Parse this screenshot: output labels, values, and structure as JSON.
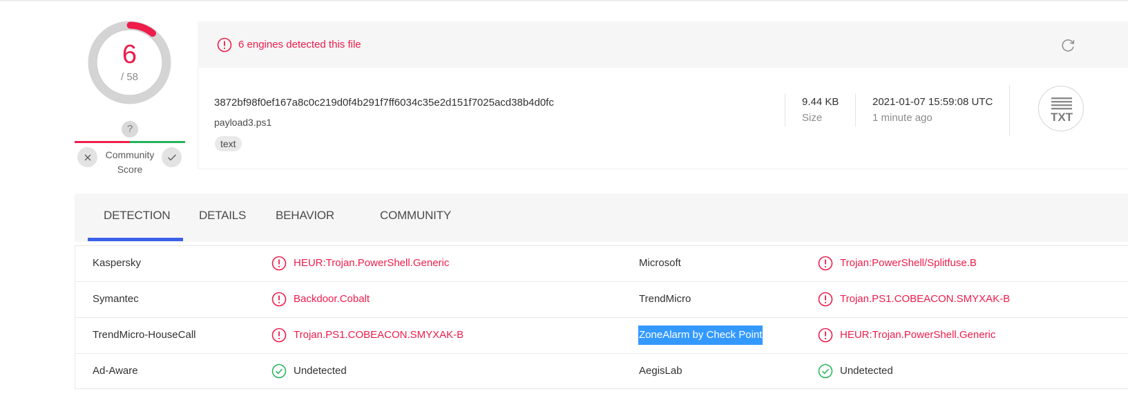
{
  "score": {
    "detected": "6",
    "total": "/ 58",
    "detected_count": 6,
    "total_count": 58,
    "ring_color": "#ed1c4b",
    "community_icon": "question-icon",
    "community_label_line1": "Community",
    "community_label_line2": "Score"
  },
  "banner": {
    "text": "6 engines detected this file",
    "color": "#ed1c4b",
    "icon": "alert-circle-icon",
    "refresh_icon": "refresh-icon"
  },
  "file": {
    "hash": "3872bf98f0ef167a8c0c219d0f4b291f7ff6034c35e2d151f7025acd38b4d0fc",
    "name": "payload3.ps1",
    "tag": "text",
    "size_value": "9.44 KB",
    "size_label": "Size",
    "date_value": "2021-01-07 15:59:08 UTC",
    "date_ago": "1 minute ago",
    "type_label": "TXT"
  },
  "tabs": [
    {
      "label": "DETECTION",
      "active": true
    },
    {
      "label": "DETAILS",
      "active": false
    },
    {
      "label": "BEHAVIOR",
      "active": false
    },
    {
      "label": "COMMUNITY",
      "active": false
    }
  ],
  "accent_color": "#3b61e8",
  "detections": [
    {
      "left_engine": "Kaspersky",
      "left_result": "HEUR:Trojan.PowerShell.Generic",
      "left_status": "malicious",
      "right_engine": "Microsoft",
      "right_result": "Trojan:PowerShell/Splitfuse.B",
      "right_status": "malicious"
    },
    {
      "left_engine": "Symantec",
      "left_result": "Backdoor.Cobalt",
      "left_status": "malicious",
      "right_engine": "TrendMicro",
      "right_result": "Trojan.PS1.COBEACON.SMYXAK-B",
      "right_status": "malicious"
    },
    {
      "left_engine": "TrendMicro-HouseCall",
      "left_result": "Trojan.PS1.COBEACON.SMYXAK-B",
      "left_status": "malicious",
      "right_engine": "ZoneAlarm by Check Point",
      "right_result": "HEUR:Trojan.PowerShell.Generic",
      "right_status": "malicious"
    },
    {
      "left_engine": "Ad-Aware",
      "left_result": "Undetected",
      "left_status": "clean",
      "right_engine": "AegisLab",
      "right_result": "Undetected",
      "right_status": "clean"
    }
  ],
  "status_colors": {
    "malicious": "#ed1c4b",
    "clean": "#21b358"
  }
}
